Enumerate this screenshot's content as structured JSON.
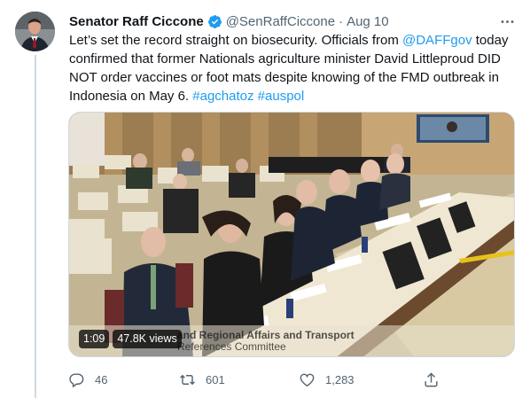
{
  "tweet": {
    "author_name": "Senator Raff Ciccone",
    "handle": "@SenRaffCiccone",
    "separator": "·",
    "date": "Aug 10",
    "text_parts": [
      {
        "text": "Let’s set the record straight on biosecurity. Officials from ",
        "link": false
      },
      {
        "text": "@DAFFgov",
        "link": true
      },
      {
        "text": " today confirmed that former Nationals agriculture minister David Littleproud DID NOT order vaccines or foot mats despite knowing of the FMD outbreak in Indonesia on May 6. ",
        "link": false
      },
      {
        "text": "#agchatoz",
        "link": true
      },
      {
        "text": " ",
        "link": false
      },
      {
        "text": "#auspol",
        "link": true
      }
    ]
  },
  "video": {
    "duration": "1:09",
    "views": "47.8K views",
    "caption_line1": "and Regional Affairs and Transport",
    "caption_line2": "References Committee"
  },
  "actions": {
    "replies": "46",
    "retweets": "601",
    "likes": "1,283"
  },
  "colors": {
    "link": "#1d9bf0",
    "verified": "#1d9bf0",
    "muted": "#536471"
  }
}
